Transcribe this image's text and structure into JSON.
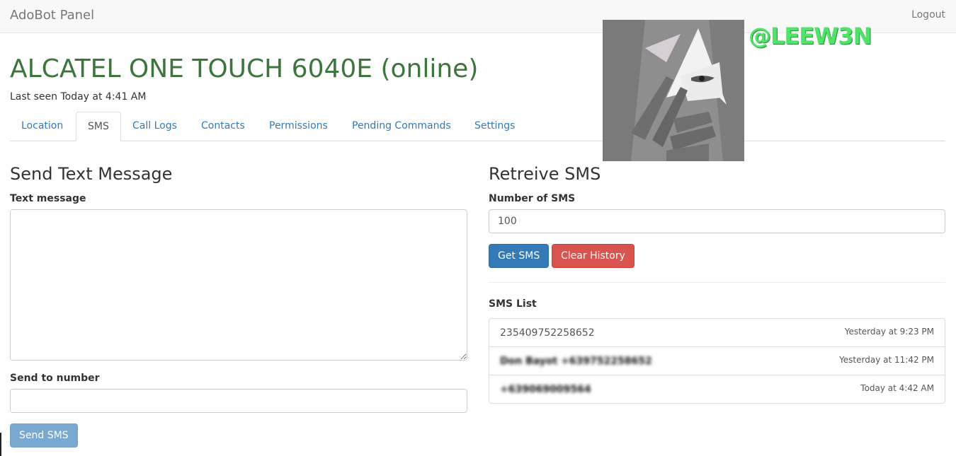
{
  "navbar": {
    "brand": "AdoBot Panel",
    "logout": "Logout"
  },
  "device": {
    "title": "ALCATEL ONE TOUCH 6040E (online)",
    "last_seen": "Last seen Today at 4:41 AM"
  },
  "tabs": [
    {
      "label": "Location",
      "active": false
    },
    {
      "label": "SMS",
      "active": true
    },
    {
      "label": "Call Logs",
      "active": false
    },
    {
      "label": "Contacts",
      "active": false
    },
    {
      "label": "Permissions",
      "active": false
    },
    {
      "label": "Pending Commands",
      "active": false
    },
    {
      "label": "Settings",
      "active": false
    }
  ],
  "send": {
    "heading": "Send Text Message",
    "message_label": "Text message",
    "message_value": "",
    "number_label": "Send to number",
    "number_value": "",
    "button": "Send SMS"
  },
  "retrieve": {
    "heading": "Retreive SMS",
    "count_label": "Number of SMS",
    "count_value": "100",
    "get_button": "Get SMS",
    "clear_button": "Clear History",
    "list_label": "SMS List",
    "items": [
      {
        "sender": "235409752258652",
        "time": "Yesterday at 9:23 PM",
        "redacted": false
      },
      {
        "sender": "Don Bayot +639752258652",
        "time": "Yesterday at 11:42 PM",
        "redacted": true
      },
      {
        "sender": "+639069009564",
        "time": "Today at 4:42 AM",
        "redacted": true
      }
    ]
  },
  "overlay": {
    "watermark": "@LEEW3N",
    "avatar_icon": "anime-character-avatar"
  },
  "colors": {
    "title_green": "#3c763d",
    "link_blue": "#337ab7",
    "primary": "#337ab7",
    "danger": "#d9534f",
    "watermark_green": "#4fe36a"
  }
}
